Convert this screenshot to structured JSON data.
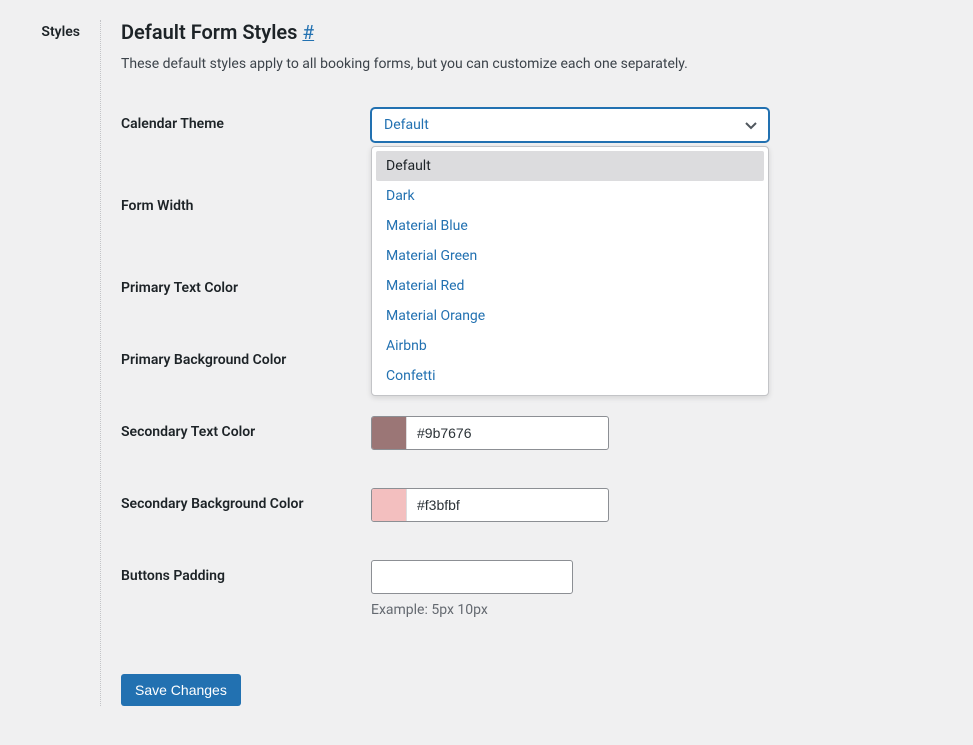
{
  "sidebar": {
    "label": "Styles"
  },
  "header": {
    "title": "Default Form Styles",
    "anchor": "#",
    "description": "These default styles apply to all booking forms, but you can customize each one separately."
  },
  "fields": {
    "calendar_theme": {
      "label": "Calendar Theme",
      "selected": "Default",
      "options": [
        "Default",
        "Dark",
        "Material Blue",
        "Material Green",
        "Material Red",
        "Material Orange",
        "Airbnb",
        "Confetti"
      ]
    },
    "form_width": {
      "label": "Form Width"
    },
    "primary_text_color": {
      "label": "Primary Text Color"
    },
    "primary_bg_color": {
      "label": "Primary Background Color"
    },
    "secondary_text_color": {
      "label": "Secondary Text Color",
      "value": "#9b7676",
      "swatch": "#9b7676"
    },
    "secondary_bg_color": {
      "label": "Secondary Background Color",
      "value": "#f3bfbf",
      "swatch": "#f3bfbf"
    },
    "buttons_padding": {
      "label": "Buttons Padding",
      "value": "",
      "hint": "Example: 5px 10px"
    }
  },
  "actions": {
    "save": "Save Changes"
  }
}
